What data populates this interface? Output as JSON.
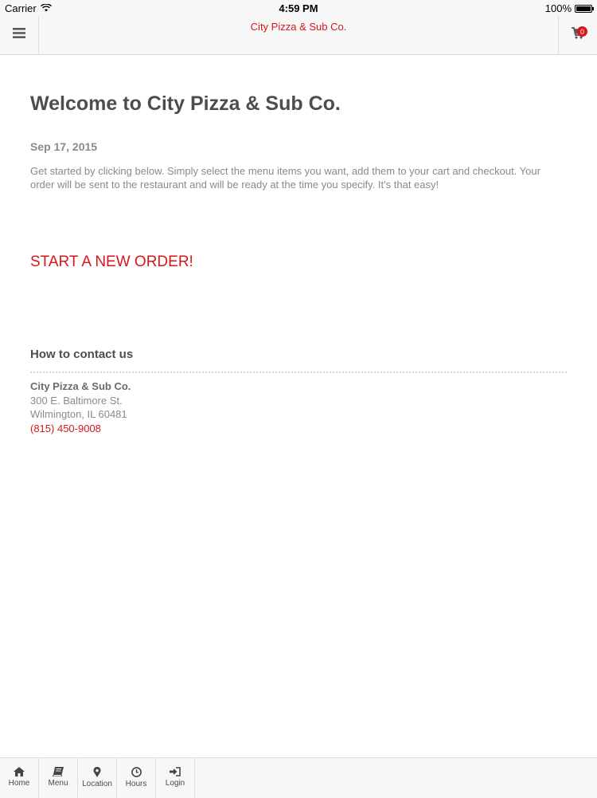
{
  "status_bar": {
    "carrier": "Carrier",
    "time": "4:59 PM",
    "battery": "100%"
  },
  "nav_bar": {
    "title": "City Pizza & Sub Co.",
    "cart_count": "0",
    "menu_icon": "hamburger-icon",
    "cart_icon": "cart-icon"
  },
  "main": {
    "title": "Welcome to City Pizza & Sub Co.",
    "date": "Sep 17, 2015",
    "intro": "Get started by clicking below. Simply select the menu items you want, add them to your cart and checkout. Your order will be sent to the restaurant and will be ready at the time you specify. It's that easy!",
    "start_order_label": "START A NEW ORDER!"
  },
  "contact": {
    "heading": "How to contact us",
    "name": "City Pizza & Sub Co.",
    "address_line1": "300 E. Baltimore St.",
    "address_line2": "Wilmington, IL 60481",
    "phone": "(815) 450-9008"
  },
  "tab_bar": {
    "items": [
      {
        "label": "Home",
        "icon": "home-icon"
      },
      {
        "label": "Menu",
        "icon": "book-icon"
      },
      {
        "label": "Location",
        "icon": "map-marker-icon"
      },
      {
        "label": "Hours",
        "icon": "clock-icon"
      },
      {
        "label": "Login",
        "icon": "sign-in-icon"
      }
    ]
  },
  "colors": {
    "accent": "#d7161b",
    "muted_text": "#8a8a8a",
    "heading_text": "#4d4d4d",
    "bar_background": "#f7f7f7"
  }
}
